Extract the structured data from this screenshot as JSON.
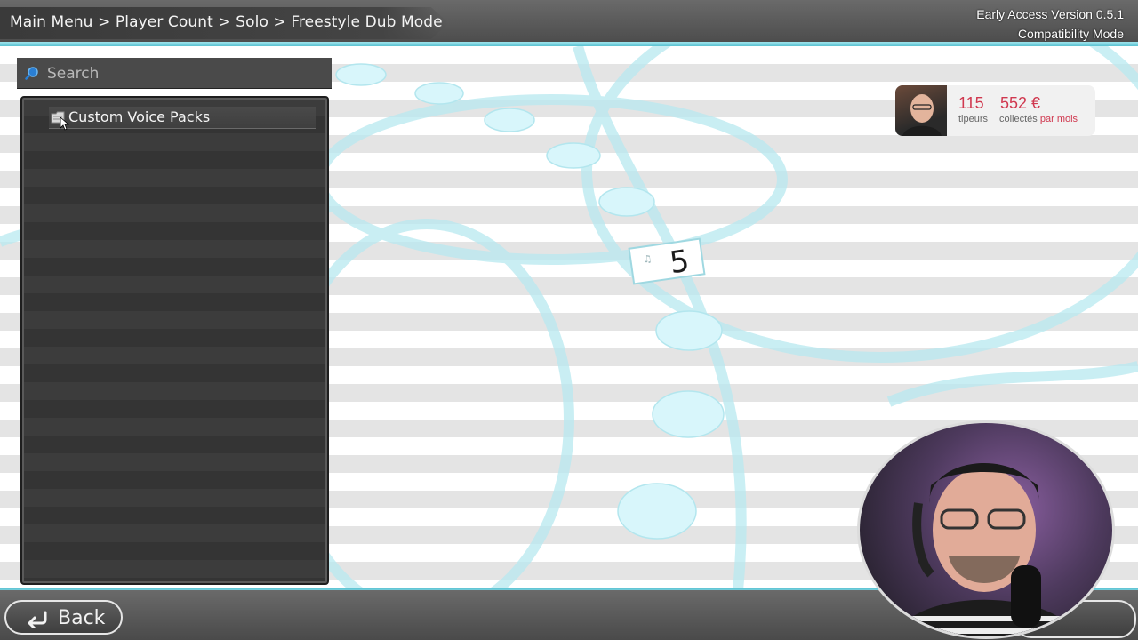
{
  "header": {
    "breadcrumb": "Main Menu > Player Count > Solo > Freestyle Dub Mode",
    "version": "Early Access Version 0.5.1",
    "mode": "Compatibility Mode"
  },
  "search": {
    "placeholder": "Search",
    "icon": "search-icon"
  },
  "list": {
    "items": [
      {
        "label": "Custom Voice Packs",
        "icon": "folder-icon"
      }
    ]
  },
  "tip_card": {
    "tippers_count": "115",
    "tippers_label": "tipeurs",
    "amount": "552 €",
    "amount_label_prefix": "collectés",
    "amount_label_suffix": "par mois"
  },
  "stage": {
    "marker_number": "5"
  },
  "footer": {
    "back_label": "Back",
    "back_icon": "back-arrow-icon"
  },
  "colors": {
    "accent": "#5cc3d2",
    "bubble": "#d8f6fb",
    "tip_accent": "#d0384f"
  }
}
